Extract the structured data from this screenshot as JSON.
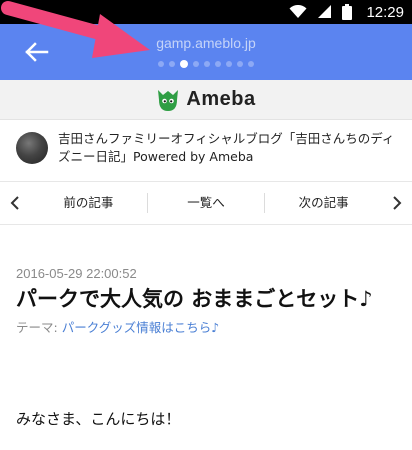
{
  "status_bar": {
    "time": "12:29"
  },
  "app_bar": {
    "url": "gamp.ameblo.jp",
    "page_count": 9,
    "active_page": 2
  },
  "colors": {
    "app_bar": "#5b84f0",
    "link": "#4a7fd4",
    "annotation": "#f0467a",
    "ameba_green": "#2f9e44"
  },
  "header": {
    "brand": "Ameba"
  },
  "blog": {
    "title": "吉田さんファミリーオフィシャルブログ「吉田さんちのディズニー日記」Powered by Ameba"
  },
  "nav": {
    "prev": "前の記事",
    "list": "一覧へ",
    "next": "次の記事"
  },
  "article": {
    "date": "2016-05-29 22:00:52",
    "title": "パークで大人気の おままごとセット♪",
    "theme_label": "テーマ:",
    "theme_link": "パークグッズ情報はこちら♪",
    "body": "みなさま、こんにちは！"
  }
}
